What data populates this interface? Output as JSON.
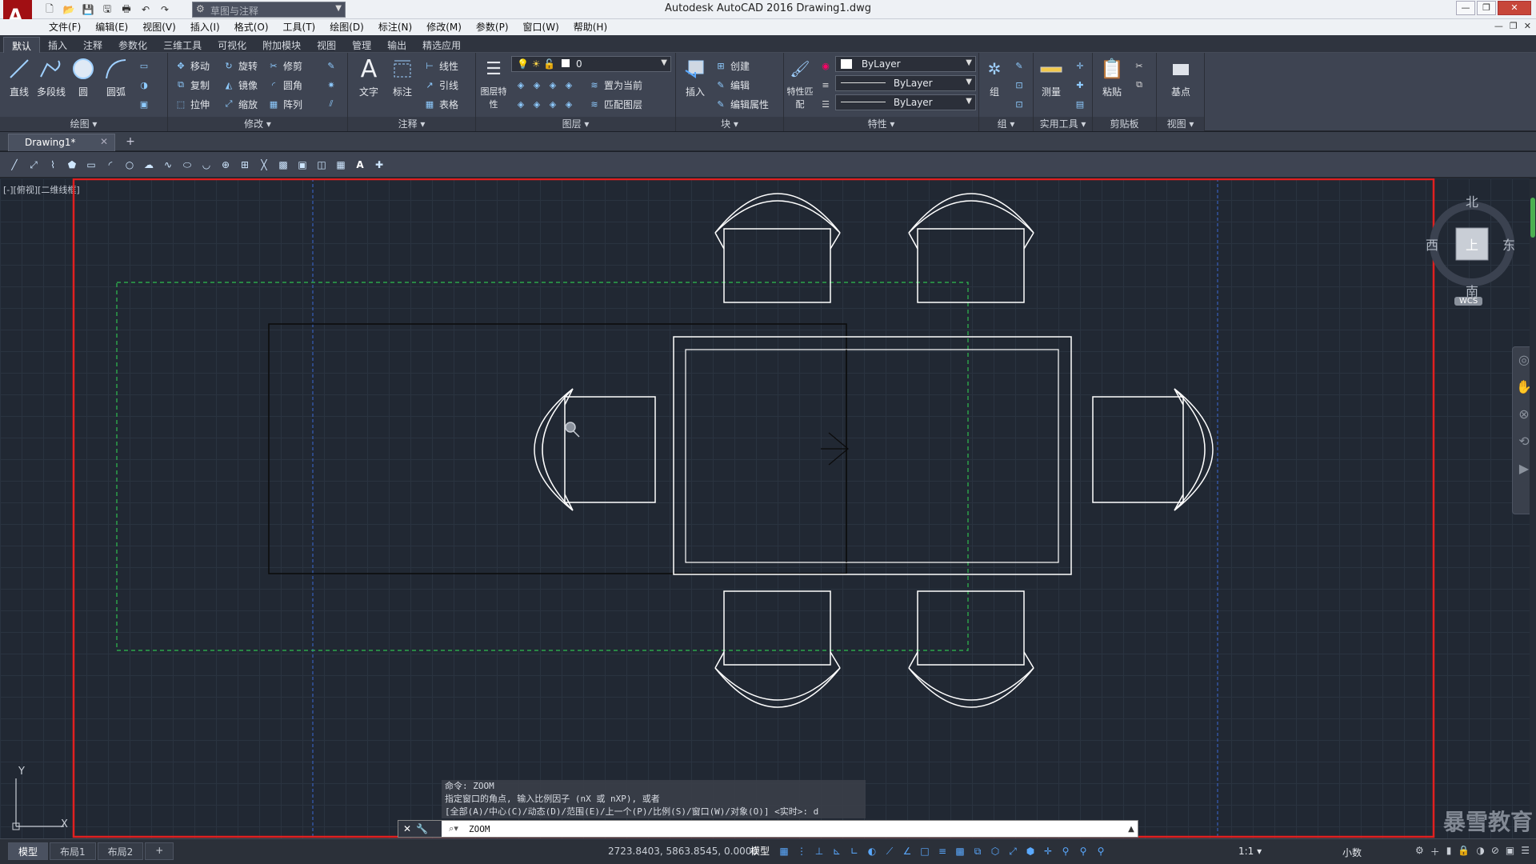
{
  "window": {
    "app_letter": "A",
    "title": "Autodesk AutoCAD 2016    Drawing1.dwg",
    "workspace": "草图与注释",
    "controls": [
      "—",
      "❐",
      "✕"
    ]
  },
  "menubar": {
    "items": [
      "文件(F)",
      "编辑(E)",
      "视图(V)",
      "插入(I)",
      "格式(O)",
      "工具(T)",
      "绘图(D)",
      "标注(N)",
      "修改(M)",
      "参数(P)",
      "窗口(W)",
      "帮助(H)"
    ],
    "doc_controls": [
      "—",
      "❐",
      "✕"
    ]
  },
  "ribbon_tabs": [
    "默认",
    "插入",
    "注释",
    "参数化",
    "三维工具",
    "可视化",
    "附加模块",
    "视图",
    "管理",
    "输出",
    "精选应用"
  ],
  "ribbon": {
    "draw": {
      "title": "绘图 ▾",
      "tools": [
        "直线",
        "多段线",
        "圆",
        "圆弧"
      ]
    },
    "modify": {
      "title": "修改 ▾",
      "tools": [
        "移动",
        "旋转",
        "修剪",
        "复制",
        "镜像",
        "圆角",
        "拉伸",
        "缩放",
        "阵列"
      ]
    },
    "annotation": {
      "title": "注释 ▾",
      "big": [
        "文字",
        "标注"
      ],
      "small": [
        "线性",
        "引线",
        "表格"
      ]
    },
    "layers": {
      "title": "图层 ▾",
      "big": "图层特性",
      "layer_value": "0",
      "small": [
        "置为当前",
        "匹配图层"
      ]
    },
    "block": {
      "title": "块 ▾",
      "big": "插入",
      "small": [
        "创建",
        "编辑",
        "编辑属性"
      ]
    },
    "properties": {
      "title": "特性 ▾",
      "big": "特性匹配",
      "color": "ByLayer",
      "linetype": "ByLayer",
      "lineweight": "ByLayer"
    },
    "groups": {
      "title": "组 ▾",
      "big": "组"
    },
    "utilities": {
      "title": "实用工具 ▾",
      "big": "测量"
    },
    "clipboard": {
      "title": "剪贴板",
      "big": "粘贴"
    },
    "view": {
      "title": "视图 ▾",
      "big": "基点"
    }
  },
  "file_tab": {
    "name": "Drawing1*",
    "close": "✕",
    "new": "+"
  },
  "canvas": {
    "viewport_label": "[-][俯视][二维线框]",
    "compass": {
      "north": "北",
      "south": "南",
      "east": "东",
      "west": "西",
      "top": "上",
      "wcs": "WCS"
    },
    "ucs": {
      "x": "X",
      "y": "Y"
    },
    "watermark": "暴雪教育"
  },
  "command": {
    "history": [
      "命令: ZOOM",
      "指定窗口的角点, 输入比例因子 (nX 或 nXP), 或者",
      "[全部(A)/中心(C)/动态(D)/范围(E)/上一个(P)/比例(S)/窗口(W)/对象(O)] <实时>: d"
    ],
    "input_value": "ZOOM"
  },
  "statusbar": {
    "layout_tabs": [
      "模型",
      "布局1",
      "布局2"
    ],
    "add_tab": "+",
    "coordinates": "2723.8403, 5863.8545, 0.0000",
    "model_label": "模型",
    "scale": "1:1 ▾",
    "units": "小数"
  },
  "colors": {
    "canvas_bg": "#212833",
    "highlight_frame": "#e02020",
    "dynamic_zoom_box": "#2fbf4f",
    "drawing_lines": "#ffffff"
  }
}
